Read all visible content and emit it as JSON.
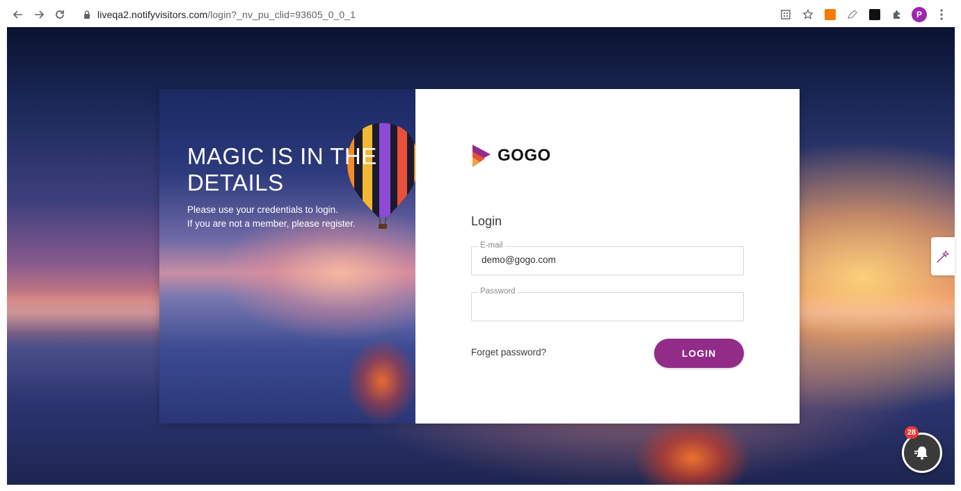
{
  "browser": {
    "url_host": "liveqa2.notifyvisitors.com",
    "url_path": "/login?_nv_pu_clid=93605_0_0_1",
    "profile_initial": "P"
  },
  "hero": {
    "headline_line1": "MAGIC IS IN THE",
    "headline_line2": "DETAILS",
    "subtext_line1": "Please use your credentials to login.",
    "subtext_line2": "If you are not a member, please register."
  },
  "brand": {
    "name": "GOGO"
  },
  "form": {
    "title": "Login",
    "email_label": "E-mail",
    "email_value": "demo@gogo.com",
    "password_label": "Password",
    "password_value": "",
    "forget_label": "Forget password?",
    "submit_label": "LOGIN"
  },
  "notifications": {
    "count": "28"
  },
  "colors": {
    "accent": "#922c88",
    "badge": "#e53935",
    "avatar": "#9c27b0"
  },
  "icons": [
    "back-arrow-icon",
    "forward-arrow-icon",
    "reload-icon",
    "lock-icon",
    "qr-code-icon",
    "star-icon",
    "extension-icon",
    "menu-dots-icon",
    "magic-wand-icon",
    "bell-icon"
  ]
}
